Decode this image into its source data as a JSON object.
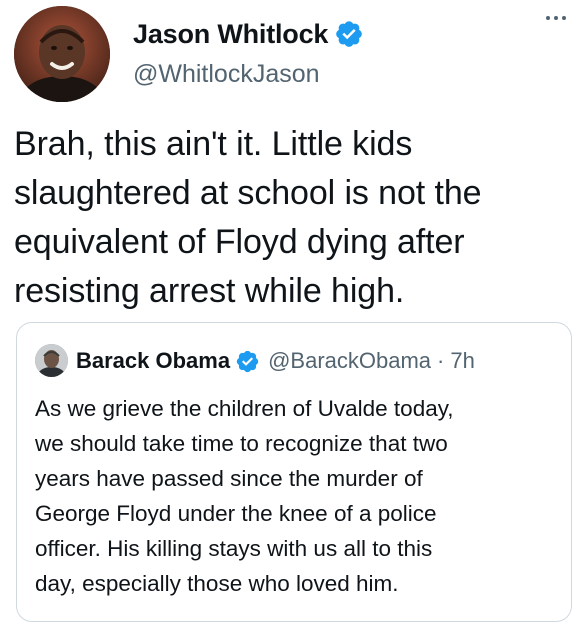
{
  "tweet": {
    "author": {
      "display_name": "Jason Whitlock",
      "handle": "@WhitlockJason",
      "verified": true,
      "avatar_icon": "profile-photo"
    },
    "more_icon": "more-horizontal-icon",
    "text_lines": [
      "Brah, this ain't it. Little kids",
      "slaughtered at school is not the",
      "equivalent of Floyd dying after",
      "resisting arrest while high."
    ]
  },
  "quoted_tweet": {
    "author": {
      "display_name": "Barack Obama",
      "handle": "@BarackObama",
      "verified": true,
      "avatar_icon": "profile-photo"
    },
    "separator": "·",
    "time": "7h",
    "text_lines": [
      "As we grieve the children of Uvalde today,",
      "we should take time to recognize that two",
      "years have passed since the murder of",
      "George Floyd under the knee of a police",
      "officer. His killing stays with us all to this",
      "day, especially those who loved him."
    ]
  },
  "colors": {
    "text_primary": "#0f1419",
    "text_secondary": "#536471",
    "verified_blue": "#1d9bf0",
    "border": "#cfd9de"
  }
}
